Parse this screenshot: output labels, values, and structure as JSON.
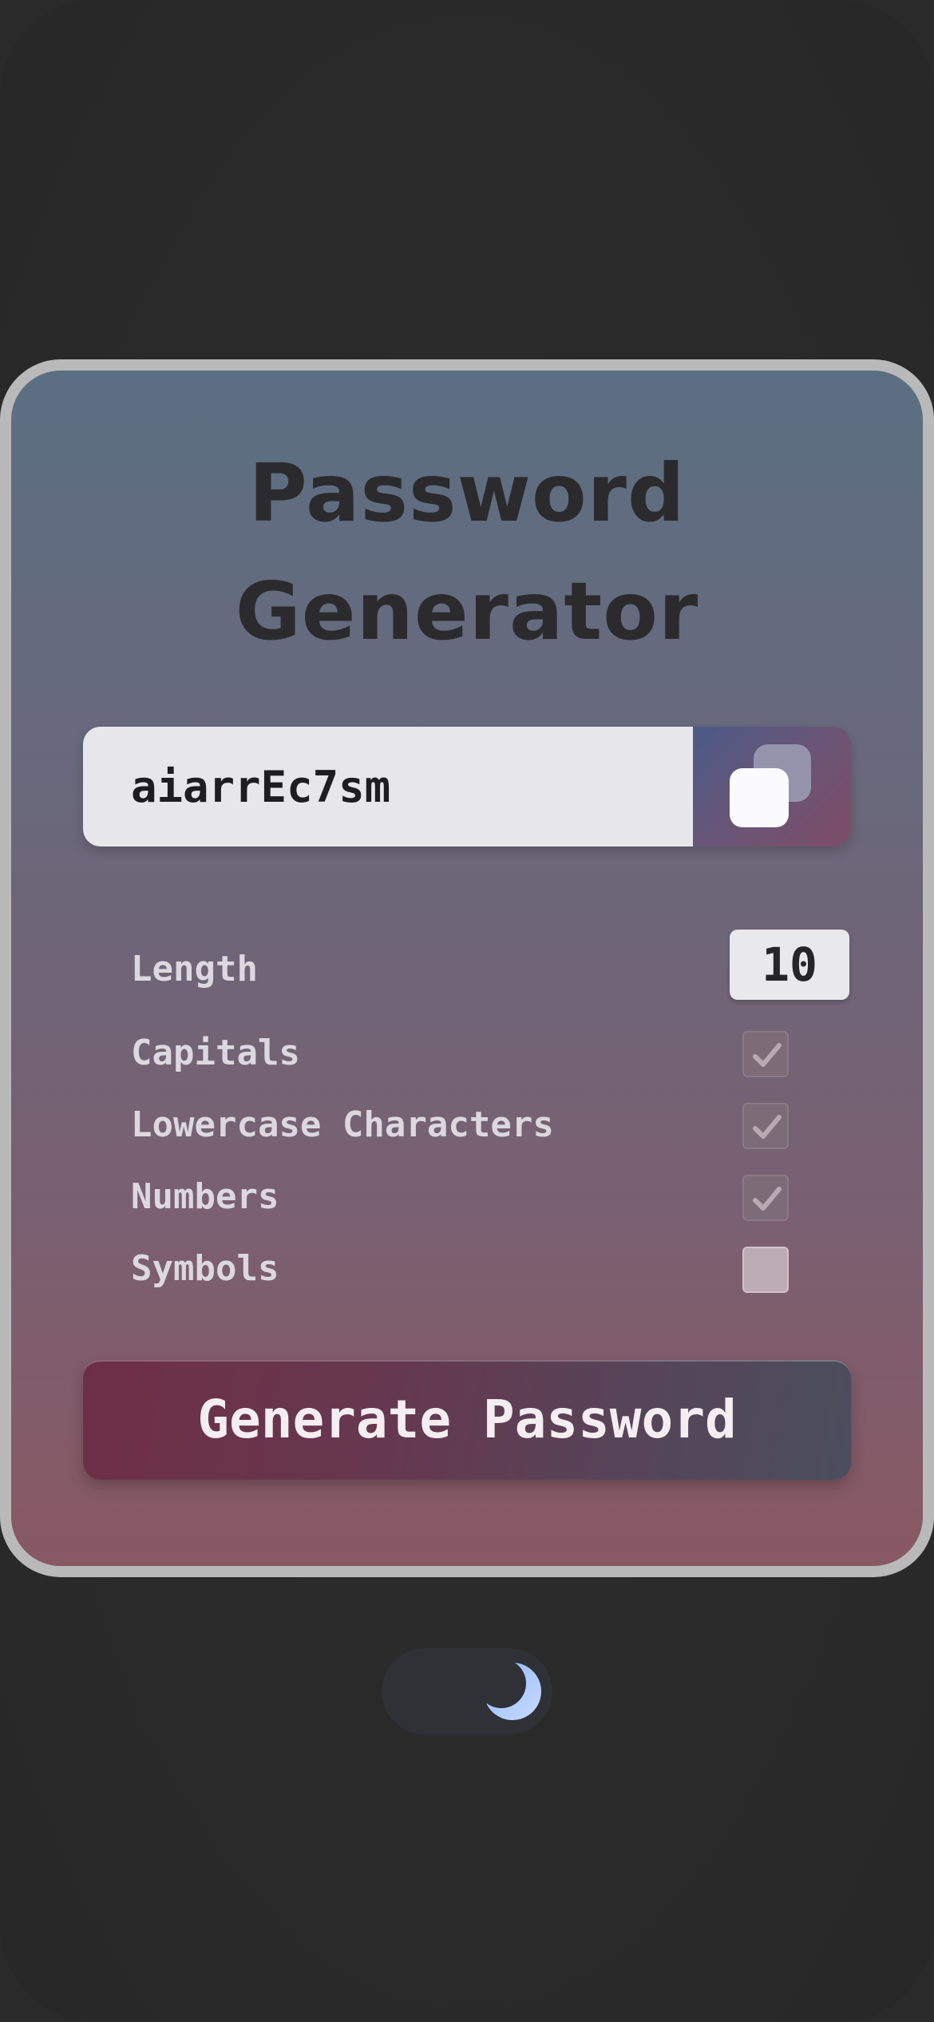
{
  "app": {
    "title_line1": "Password",
    "title_line2": "Generator"
  },
  "password": {
    "value": "aiarrEc7sm"
  },
  "copy_button": {
    "icon": "copy-icon"
  },
  "options": {
    "length": {
      "label": "Length",
      "value": "10"
    },
    "capitals": {
      "label": "Capitals",
      "checked": true
    },
    "lowercase": {
      "label": "Lowercase Characters",
      "checked": true
    },
    "numbers": {
      "label": "Numbers",
      "checked": true
    },
    "symbols": {
      "label": "Symbols",
      "checked": false
    }
  },
  "generate_button": {
    "label": "Generate Password"
  },
  "theme_toggle": {
    "icon": "moon-icon",
    "mode": "dark"
  },
  "colors": {
    "background": "#2a2a2a",
    "card_border": "#b9b9b9",
    "accent_maroon": "#6e2f45",
    "accent_slate": "#4a4e5e"
  }
}
